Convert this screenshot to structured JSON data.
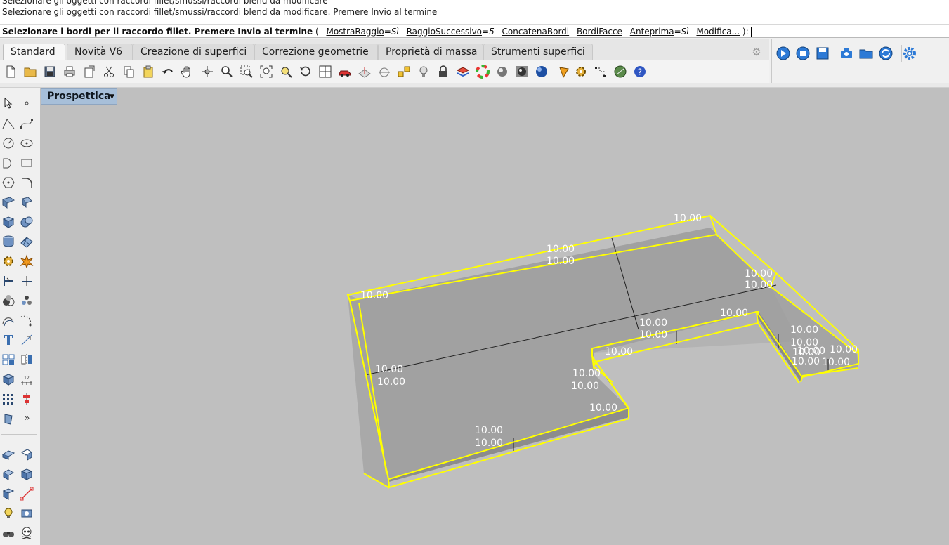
{
  "command": {
    "history": [
      "Selezionare gli oggetti con raccordi fillet/smussi/raccordi blend da modificare",
      "Selezionare gli oggetti con raccordi fillet/smussi/raccordi blend da modificare. Premere Invio al termine"
    ],
    "prompt": "Selezionare i bordi per il raccordo fillet. Premere Invio al termine",
    "paren_open": "(",
    "paren_close": "):",
    "options": [
      {
        "key": "MostraRaggio",
        "eq": "=",
        "value": "Sì"
      },
      {
        "key": "RaggioSuccessivo",
        "eq": "=",
        "value": "5"
      },
      {
        "key": "ConcatenaBordi",
        "eq": "",
        "value": ""
      },
      {
        "key": "BordiFacce",
        "eq": "",
        "value": ""
      },
      {
        "key": "Anteprima",
        "eq": "=",
        "value": "Sì"
      },
      {
        "key": "Modifica...",
        "eq": "",
        "value": ""
      }
    ]
  },
  "tabs": [
    {
      "label": "Standard",
      "active": true
    },
    {
      "label": "Novità V6"
    },
    {
      "label": "Creazione di superfici"
    },
    {
      "label": "Correzione geometrie"
    },
    {
      "label": "Proprietà di massa"
    },
    {
      "label": "Strumenti superfici"
    }
  ],
  "viewport": {
    "name": "Prospettica",
    "background": "#bfbfbf",
    "selection_color": "#ffff00",
    "dimension_labels": [
      "10.00",
      "10.00",
      "10.00",
      "10.00",
      "10.00",
      "10.00",
      "10.00",
      "10.00",
      "10.00",
      "10.00",
      "10.00",
      "10.00",
      "10.00",
      "10.00",
      "10.00",
      "10.00",
      "10.00",
      "10.00",
      "10.00",
      "10.00",
      "10.00",
      "10.00",
      "10.00",
      "10.00"
    ]
  },
  "left_toolbar": {
    "more": "»"
  }
}
